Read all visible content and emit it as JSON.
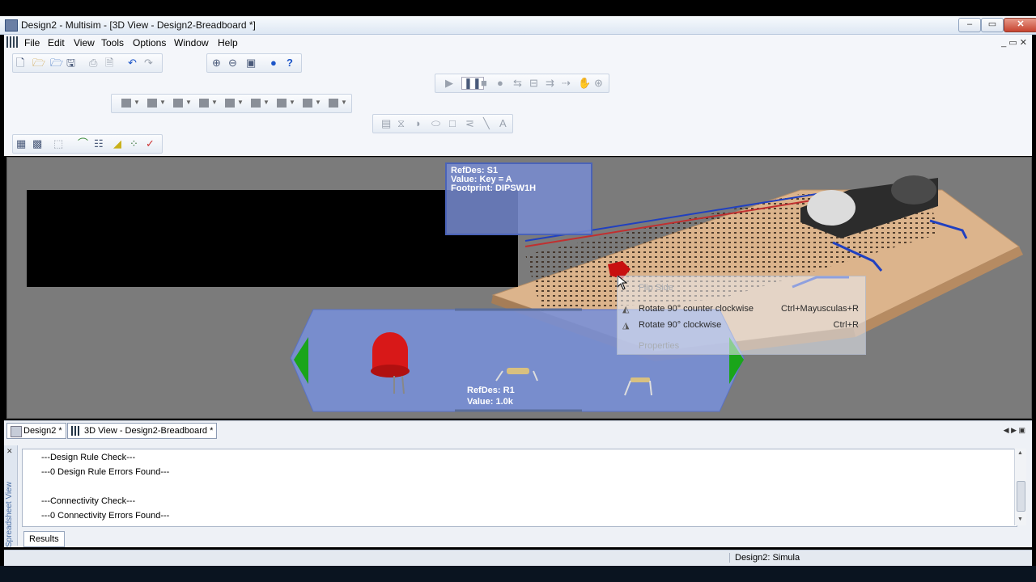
{
  "window": {
    "title": "Design2 - Multisim - [3D View - Design2-Breadboard *]",
    "minimize": "–",
    "restore": "▭",
    "close": "✕"
  },
  "menu": {
    "items": [
      "File",
      "Edit",
      "View",
      "Tools",
      "Options",
      "Window",
      "Help"
    ],
    "mdi_controls": "_ ▭ ✕"
  },
  "viewport": {
    "tooltip_top": {
      "refdes": "RefDes: S1",
      "value": "Value: Key = A",
      "footprint": "Footprint: DIPSW1H"
    },
    "tray_info": {
      "refdes": "RefDes: R1",
      "value": "Value: 1.0k"
    },
    "context_menu": {
      "items": [
        {
          "label": "Flip Side",
          "shortcut": "",
          "enabled": false
        },
        {
          "label": "Rotate 90° counter clockwise",
          "shortcut": "Ctrl+Mayusculas+R",
          "enabled": true
        },
        {
          "label": "Rotate 90° clockwise",
          "shortcut": "Ctrl+R",
          "enabled": true
        },
        {
          "label": "Properties",
          "shortcut": "",
          "enabled": false
        }
      ]
    }
  },
  "tabs": [
    {
      "label": "Design2 *"
    },
    {
      "label": "3D View - Design2-Breadboard *"
    }
  ],
  "results": {
    "lines": [
      "---Design Rule Check---",
      "---0 Design Rule Errors Found---",
      "",
      "---Connectivity Check---",
      "---0 Connectivity Errors Found---"
    ],
    "tab_label": "Results",
    "side_label": "Spreadsheet View"
  },
  "status": {
    "text": "Design2: Simula"
  },
  "colors": {
    "viewport_bg": "#7b7b7b",
    "tooltip_bg": "#788cd2",
    "tray_bg": "#7890d8",
    "arrow_green": "#1aa51a",
    "led_red": "#d81818"
  }
}
